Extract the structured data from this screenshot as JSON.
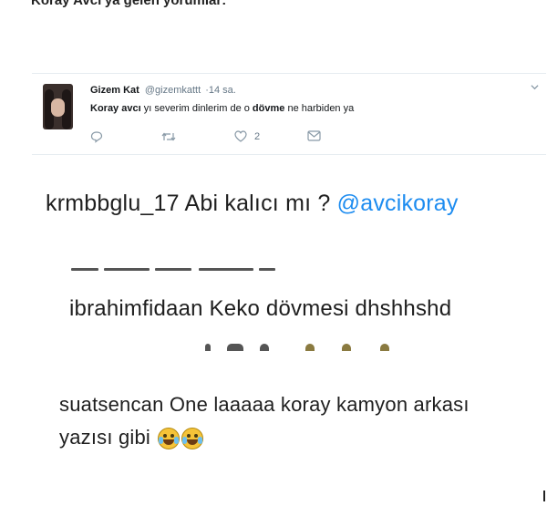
{
  "heading": "Koray Avcı'ya gelen yorumlar:",
  "tweet": {
    "name": "Gizem Kat",
    "handle": "@gizemkattt",
    "time": "·14 sa.",
    "body_mention": "Koray avcı",
    "body_part1": " yı severim dinlerim de o ",
    "body_bold": "dövme",
    "body_part2": " ne harbiden ya",
    "like_count": "2",
    "icons": [
      "reply-icon",
      "retweet-icon",
      "like-icon",
      "message-icon",
      "chevron-down-icon"
    ]
  },
  "comments": {
    "c1_text": "krmbbglu_17 Abi kalıcı mı ? ",
    "c1_mention": "@avcikoray",
    "c2_text": "ibrahimfidaan Keko dövmesi dhshhshd",
    "c3_line1": "suatsencan One laaaaa koray kamyon arkası",
    "c3_line2": "yazısı gibi"
  },
  "colors": {
    "mention": "#1d8cf0",
    "secondary_text": "#657786"
  }
}
